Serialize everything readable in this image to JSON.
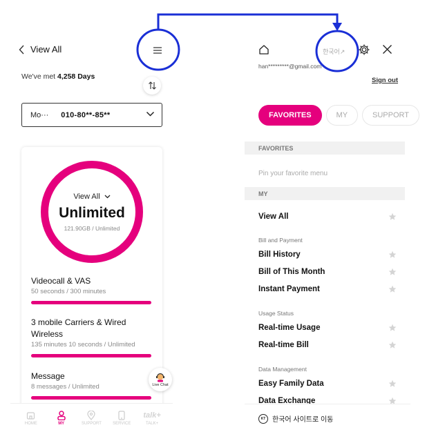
{
  "left_panel": {
    "header": {
      "title": "View All"
    },
    "met_prefix": "We've met",
    "met_days": "4,258 Days",
    "line_select": {
      "type": "Mo···",
      "number": "010-80**-85**"
    },
    "summary": {
      "view_all": "View All",
      "big": "Unlimited",
      "sub": "121.90GB / Unlimited"
    },
    "usages": [
      {
        "title": "Videocall & VAS",
        "detail": "50 seconds / 300 minutes"
      },
      {
        "title": "3 mobile Carriers & Wired Wireless",
        "detail": "135 minutes 10 seconds / Unlimited"
      },
      {
        "title": "Message",
        "detail": "8 messages / Unlimited"
      }
    ],
    "live_chat": "Live Chat",
    "nav": [
      {
        "label": "HOME",
        "icon": "home-icon"
      },
      {
        "label": "MY",
        "icon": "person-icon"
      },
      {
        "label": "SUPPORT",
        "icon": "location-pin-icon"
      },
      {
        "label": "SERVICE",
        "icon": "phone-icon"
      },
      {
        "label": "TALK+",
        "icon": "talk-logo-icon"
      }
    ]
  },
  "right_panel": {
    "language_link": "한국어↗",
    "email": "han*********@gmail.com",
    "sign_out": "Sign out",
    "tabs": [
      "FAVORITES",
      "MY",
      "SUPPORT"
    ],
    "favorites_header": "FAVORITES",
    "pin_text": "Pin your favorite menu",
    "my_header": "MY",
    "menu": {
      "view_all": "View All",
      "bill_group": "Bill and Payment",
      "bill_items": [
        "Bill History",
        "Bill of This Month",
        "Instant Payment"
      ],
      "usage_group": "Usage Status",
      "usage_items": [
        "Real-time Usage",
        "Real-time Bill"
      ],
      "data_group": "Data Management",
      "data_items": [
        "Easy Family Data",
        "Data Exchange"
      ]
    },
    "footer": {
      "logo": "KT",
      "text": "한국어 사이트로 이동"
    }
  },
  "colors": {
    "accent": "#e5007d",
    "annotation": "#1a2fd6"
  }
}
